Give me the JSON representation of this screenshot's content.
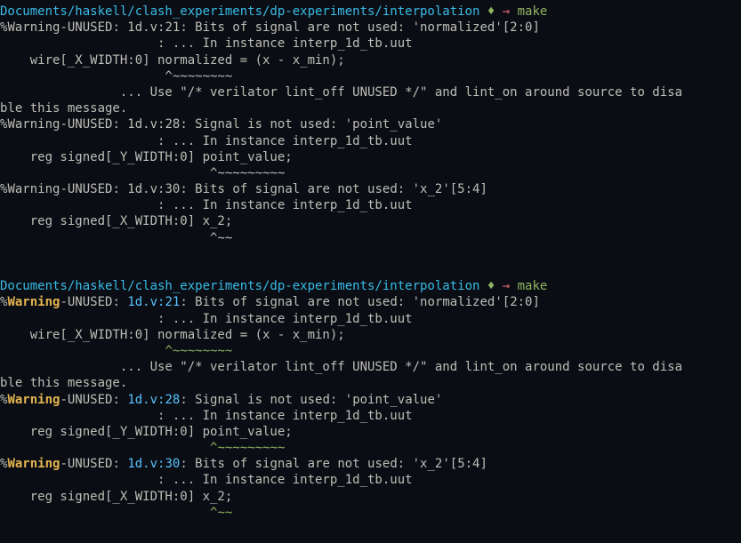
{
  "prompt1": {
    "path": "Documents/haskell/clash_experiments/dp-experiments/interpolation",
    "diamond": " ♦ ",
    "arrow": "→ ",
    "command": "make"
  },
  "block1": {
    "w1_pct": "%",
    "w1_warn": "Warning",
    "w1_rest": "-UNUSED: 1d.v:21: Bits of signal are not used: 'normalized'[2:0]",
    "w1_l2": "                     : ... In instance interp_1d_tb.uut",
    "w1_l3": "    wire[_X_WIDTH:0] normalized = (x - x_min);",
    "w1_l4": "                      ^~~~~~~~~",
    "w1_l5": "                ... Use \"/* verilator lint_off UNUSED */\" and lint_on around source to disa",
    "w1_l6": "ble this message.",
    "w2_pct": "%",
    "w2_warn": "Warning",
    "w2_rest": "-UNUSED: 1d.v:28: Signal is not used: 'point_value'",
    "w2_l2": "                     : ... In instance interp_1d_tb.uut",
    "w2_l3": "    reg signed[_Y_WIDTH:0] point_value;",
    "w2_l4": "                            ^~~~~~~~~~",
    "w3_pct": "%",
    "w3_warn": "Warning",
    "w3_rest": "-UNUSED: 1d.v:30: Bits of signal are not used: 'x_2'[5:4]",
    "w3_l2": "                     : ... In instance interp_1d_tb.uut",
    "w3_l3": "    reg signed[_X_WIDTH:0] x_2;",
    "w3_l4": "                            ^~~"
  },
  "prompt2": {
    "path": "Documents/haskell/clash_experiments/dp-experiments/interpolation",
    "diamond": " ♦ ",
    "arrow": "→ ",
    "command": "make"
  },
  "block2": {
    "w1_pct": "%",
    "w1_warn": "Warning",
    "w1_unused": "-UNUSED: ",
    "w1_file": "1d.v:21",
    "w1_rest": ": Bits of signal are not used: 'normalized'[2:0]",
    "w1_l2": "                     : ... In instance interp_1d_tb.uut",
    "w1_l3": "    wire[_X_WIDTH:0] normalized = (x - x_min);",
    "w1_caret_pad": "                      ",
    "w1_caret": "^~~~~~~~~",
    "w1_l5": "                ... Use \"/* verilator lint_off UNUSED */\" and lint_on around source to disa",
    "w1_l6": "ble this message.",
    "w2_pct": "%",
    "w2_warn": "Warning",
    "w2_unused": "-UNUSED: ",
    "w2_file": "1d.v:28",
    "w2_rest": ": Signal is not used: 'point_value'",
    "w2_l2": "                     : ... In instance interp_1d_tb.uut",
    "w2_l3": "    reg signed[_Y_WIDTH:0] point_value;",
    "w2_caret_pad": "                            ",
    "w2_caret": "^~~~~~~~~~",
    "w3_pct": "%",
    "w3_warn": "Warning",
    "w3_unused": "-UNUSED: ",
    "w3_file": "1d.v:30",
    "w3_rest": ": Bits of signal are not used: 'x_2'[5:4]",
    "w3_l2": "                     : ... In instance interp_1d_tb.uut",
    "w3_l3": "    reg signed[_X_WIDTH:0] x_2;",
    "w3_caret_pad": "                            ",
    "w3_caret": "^~~"
  }
}
